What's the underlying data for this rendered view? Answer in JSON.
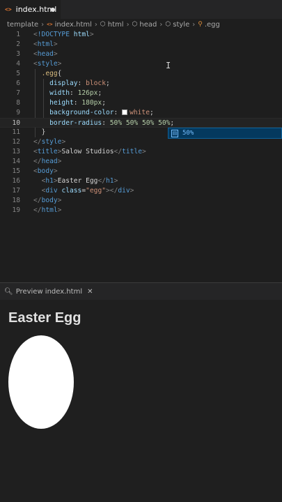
{
  "tab": {
    "icon": "<>",
    "label": "index.html"
  },
  "breadcrumb": [
    {
      "icon": "folder",
      "label": "template"
    },
    {
      "icon": "html-icon",
      "glyph": "<>",
      "label": "index.html"
    },
    {
      "icon": "cube-icon",
      "label": "html"
    },
    {
      "icon": "cube-icon",
      "label": "head"
    },
    {
      "icon": "cube-icon",
      "label": "style"
    },
    {
      "icon": "selector-icon",
      "label": ".egg"
    }
  ],
  "code_lines": [
    {
      "n": "1",
      "segments": [
        [
          "t-punc",
          "<"
        ],
        [
          "t-tag",
          "!DOCTYPE"
        ],
        [
          "t-text",
          " "
        ],
        [
          "t-attr",
          "html"
        ],
        [
          "t-punc",
          ">"
        ]
      ]
    },
    {
      "n": "2",
      "segments": [
        [
          "t-punc",
          "<"
        ],
        [
          "t-tag",
          "html"
        ],
        [
          "t-punc",
          ">"
        ]
      ]
    },
    {
      "n": "3",
      "segments": [
        [
          "t-punc",
          "<"
        ],
        [
          "t-tag",
          "head"
        ],
        [
          "t-punc",
          ">"
        ]
      ]
    },
    {
      "n": "4",
      "segments": [
        [
          "t-punc",
          "<"
        ],
        [
          "t-tag",
          "style"
        ],
        [
          "t-punc",
          ">"
        ]
      ]
    },
    {
      "n": "5",
      "segments": [
        [
          "t-text",
          "  "
        ],
        [
          "t-sel",
          ".egg"
        ],
        [
          "t-text",
          "{"
        ]
      ]
    },
    {
      "n": "6",
      "segments": [
        [
          "t-text",
          "    "
        ],
        [
          "t-prop",
          "display"
        ],
        [
          "t-text",
          ": "
        ],
        [
          "t-val",
          "block"
        ],
        [
          "t-text",
          ";"
        ]
      ]
    },
    {
      "n": "7",
      "segments": [
        [
          "t-text",
          "    "
        ],
        [
          "t-prop",
          "width"
        ],
        [
          "t-text",
          ": "
        ],
        [
          "t-num",
          "126px"
        ],
        [
          "t-text",
          ";"
        ]
      ]
    },
    {
      "n": "8",
      "segments": [
        [
          "t-text",
          "    "
        ],
        [
          "t-prop",
          "height"
        ],
        [
          "t-text",
          ": "
        ],
        [
          "t-num",
          "180px"
        ],
        [
          "t-text",
          ";"
        ]
      ]
    },
    {
      "n": "9",
      "segments": [
        [
          "t-text",
          "    "
        ],
        [
          "t-prop",
          "background-color"
        ],
        [
          "t-text",
          ": "
        ],
        [
          "swatch",
          ""
        ],
        [
          "t-val",
          "white"
        ],
        [
          "t-text",
          ";"
        ]
      ]
    },
    {
      "n": "10",
      "segments": [
        [
          "t-text",
          "    "
        ],
        [
          "t-prop",
          "border-radius"
        ],
        [
          "t-text",
          ": "
        ],
        [
          "t-num",
          "50% 50% 50% 50%"
        ],
        [
          "t-text",
          ";"
        ]
      ]
    },
    {
      "n": "11",
      "segments": [
        [
          "t-text",
          "  "
        ],
        [
          "t-text",
          "}"
        ]
      ]
    },
    {
      "n": "12",
      "segments": [
        [
          "t-punc",
          "</"
        ],
        [
          "t-tag",
          "style"
        ],
        [
          "t-punc",
          ">"
        ]
      ]
    },
    {
      "n": "13",
      "segments": [
        [
          "t-punc",
          "<"
        ],
        [
          "t-tag",
          "title"
        ],
        [
          "t-punc",
          ">"
        ],
        [
          "t-text",
          "Salow Studios"
        ],
        [
          "t-punc",
          "</"
        ],
        [
          "t-tag",
          "title"
        ],
        [
          "t-punc",
          ">"
        ]
      ]
    },
    {
      "n": "14",
      "segments": [
        [
          "t-punc",
          "</"
        ],
        [
          "t-tag",
          "head"
        ],
        [
          "t-punc",
          ">"
        ]
      ]
    },
    {
      "n": "15",
      "segments": [
        [
          "t-punc",
          "<"
        ],
        [
          "t-tag",
          "body"
        ],
        [
          "t-punc",
          ">"
        ]
      ]
    },
    {
      "n": "16",
      "segments": [
        [
          "t-text",
          "  "
        ],
        [
          "t-punc",
          "<"
        ],
        [
          "t-tag",
          "h1"
        ],
        [
          "t-punc",
          ">"
        ],
        [
          "t-text",
          "Easter Egg"
        ],
        [
          "t-punc",
          "</"
        ],
        [
          "t-tag",
          "h1"
        ],
        [
          "t-punc",
          ">"
        ]
      ]
    },
    {
      "n": "17",
      "segments": [
        [
          "t-text",
          "  "
        ],
        [
          "t-punc",
          "<"
        ],
        [
          "t-tag",
          "div"
        ],
        [
          "t-text",
          " "
        ],
        [
          "t-attr",
          "class"
        ],
        [
          "t-text",
          "="
        ],
        [
          "t-str",
          "\"egg\""
        ],
        [
          "t-punc",
          "></"
        ],
        [
          "t-tag",
          "div"
        ],
        [
          "t-punc",
          ">"
        ]
      ]
    },
    {
      "n": "18",
      "segments": [
        [
          "t-punc",
          "</"
        ],
        [
          "t-tag",
          "body"
        ],
        [
          "t-punc",
          ">"
        ]
      ]
    },
    {
      "n": "19",
      "segments": [
        [
          "t-punc",
          "</"
        ],
        [
          "t-tag",
          "html"
        ],
        [
          "t-punc",
          ">"
        ]
      ]
    }
  ],
  "current_line": "10",
  "suggestion": {
    "icon": "value-icon",
    "label": "50%"
  },
  "preview_tab": {
    "icon": "preview-icon",
    "label": "Preview index.html",
    "close": "✕"
  },
  "preview": {
    "heading": "Easter Egg",
    "egg_color": "#ffffff"
  }
}
